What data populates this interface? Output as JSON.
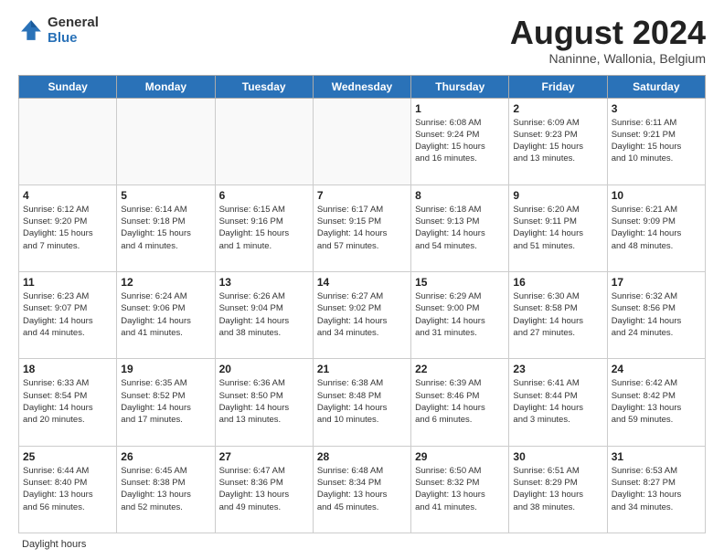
{
  "logo": {
    "general": "General",
    "blue": "Blue"
  },
  "title": "August 2024",
  "location": "Naninne, Wallonia, Belgium",
  "days_of_week": [
    "Sunday",
    "Monday",
    "Tuesday",
    "Wednesday",
    "Thursday",
    "Friday",
    "Saturday"
  ],
  "footer": "Daylight hours",
  "weeks": [
    [
      {
        "day": "",
        "info": ""
      },
      {
        "day": "",
        "info": ""
      },
      {
        "day": "",
        "info": ""
      },
      {
        "day": "",
        "info": ""
      },
      {
        "day": "1",
        "info": "Sunrise: 6:08 AM\nSunset: 9:24 PM\nDaylight: 15 hours\nand 16 minutes."
      },
      {
        "day": "2",
        "info": "Sunrise: 6:09 AM\nSunset: 9:23 PM\nDaylight: 15 hours\nand 13 minutes."
      },
      {
        "day": "3",
        "info": "Sunrise: 6:11 AM\nSunset: 9:21 PM\nDaylight: 15 hours\nand 10 minutes."
      }
    ],
    [
      {
        "day": "4",
        "info": "Sunrise: 6:12 AM\nSunset: 9:20 PM\nDaylight: 15 hours\nand 7 minutes."
      },
      {
        "day": "5",
        "info": "Sunrise: 6:14 AM\nSunset: 9:18 PM\nDaylight: 15 hours\nand 4 minutes."
      },
      {
        "day": "6",
        "info": "Sunrise: 6:15 AM\nSunset: 9:16 PM\nDaylight: 15 hours\nand 1 minute."
      },
      {
        "day": "7",
        "info": "Sunrise: 6:17 AM\nSunset: 9:15 PM\nDaylight: 14 hours\nand 57 minutes."
      },
      {
        "day": "8",
        "info": "Sunrise: 6:18 AM\nSunset: 9:13 PM\nDaylight: 14 hours\nand 54 minutes."
      },
      {
        "day": "9",
        "info": "Sunrise: 6:20 AM\nSunset: 9:11 PM\nDaylight: 14 hours\nand 51 minutes."
      },
      {
        "day": "10",
        "info": "Sunrise: 6:21 AM\nSunset: 9:09 PM\nDaylight: 14 hours\nand 48 minutes."
      }
    ],
    [
      {
        "day": "11",
        "info": "Sunrise: 6:23 AM\nSunset: 9:07 PM\nDaylight: 14 hours\nand 44 minutes."
      },
      {
        "day": "12",
        "info": "Sunrise: 6:24 AM\nSunset: 9:06 PM\nDaylight: 14 hours\nand 41 minutes."
      },
      {
        "day": "13",
        "info": "Sunrise: 6:26 AM\nSunset: 9:04 PM\nDaylight: 14 hours\nand 38 minutes."
      },
      {
        "day": "14",
        "info": "Sunrise: 6:27 AM\nSunset: 9:02 PM\nDaylight: 14 hours\nand 34 minutes."
      },
      {
        "day": "15",
        "info": "Sunrise: 6:29 AM\nSunset: 9:00 PM\nDaylight: 14 hours\nand 31 minutes."
      },
      {
        "day": "16",
        "info": "Sunrise: 6:30 AM\nSunset: 8:58 PM\nDaylight: 14 hours\nand 27 minutes."
      },
      {
        "day": "17",
        "info": "Sunrise: 6:32 AM\nSunset: 8:56 PM\nDaylight: 14 hours\nand 24 minutes."
      }
    ],
    [
      {
        "day": "18",
        "info": "Sunrise: 6:33 AM\nSunset: 8:54 PM\nDaylight: 14 hours\nand 20 minutes."
      },
      {
        "day": "19",
        "info": "Sunrise: 6:35 AM\nSunset: 8:52 PM\nDaylight: 14 hours\nand 17 minutes."
      },
      {
        "day": "20",
        "info": "Sunrise: 6:36 AM\nSunset: 8:50 PM\nDaylight: 14 hours\nand 13 minutes."
      },
      {
        "day": "21",
        "info": "Sunrise: 6:38 AM\nSunset: 8:48 PM\nDaylight: 14 hours\nand 10 minutes."
      },
      {
        "day": "22",
        "info": "Sunrise: 6:39 AM\nSunset: 8:46 PM\nDaylight: 14 hours\nand 6 minutes."
      },
      {
        "day": "23",
        "info": "Sunrise: 6:41 AM\nSunset: 8:44 PM\nDaylight: 14 hours\nand 3 minutes."
      },
      {
        "day": "24",
        "info": "Sunrise: 6:42 AM\nSunset: 8:42 PM\nDaylight: 13 hours\nand 59 minutes."
      }
    ],
    [
      {
        "day": "25",
        "info": "Sunrise: 6:44 AM\nSunset: 8:40 PM\nDaylight: 13 hours\nand 56 minutes."
      },
      {
        "day": "26",
        "info": "Sunrise: 6:45 AM\nSunset: 8:38 PM\nDaylight: 13 hours\nand 52 minutes."
      },
      {
        "day": "27",
        "info": "Sunrise: 6:47 AM\nSunset: 8:36 PM\nDaylight: 13 hours\nand 49 minutes."
      },
      {
        "day": "28",
        "info": "Sunrise: 6:48 AM\nSunset: 8:34 PM\nDaylight: 13 hours\nand 45 minutes."
      },
      {
        "day": "29",
        "info": "Sunrise: 6:50 AM\nSunset: 8:32 PM\nDaylight: 13 hours\nand 41 minutes."
      },
      {
        "day": "30",
        "info": "Sunrise: 6:51 AM\nSunset: 8:29 PM\nDaylight: 13 hours\nand 38 minutes."
      },
      {
        "day": "31",
        "info": "Sunrise: 6:53 AM\nSunset: 8:27 PM\nDaylight: 13 hours\nand 34 minutes."
      }
    ]
  ]
}
